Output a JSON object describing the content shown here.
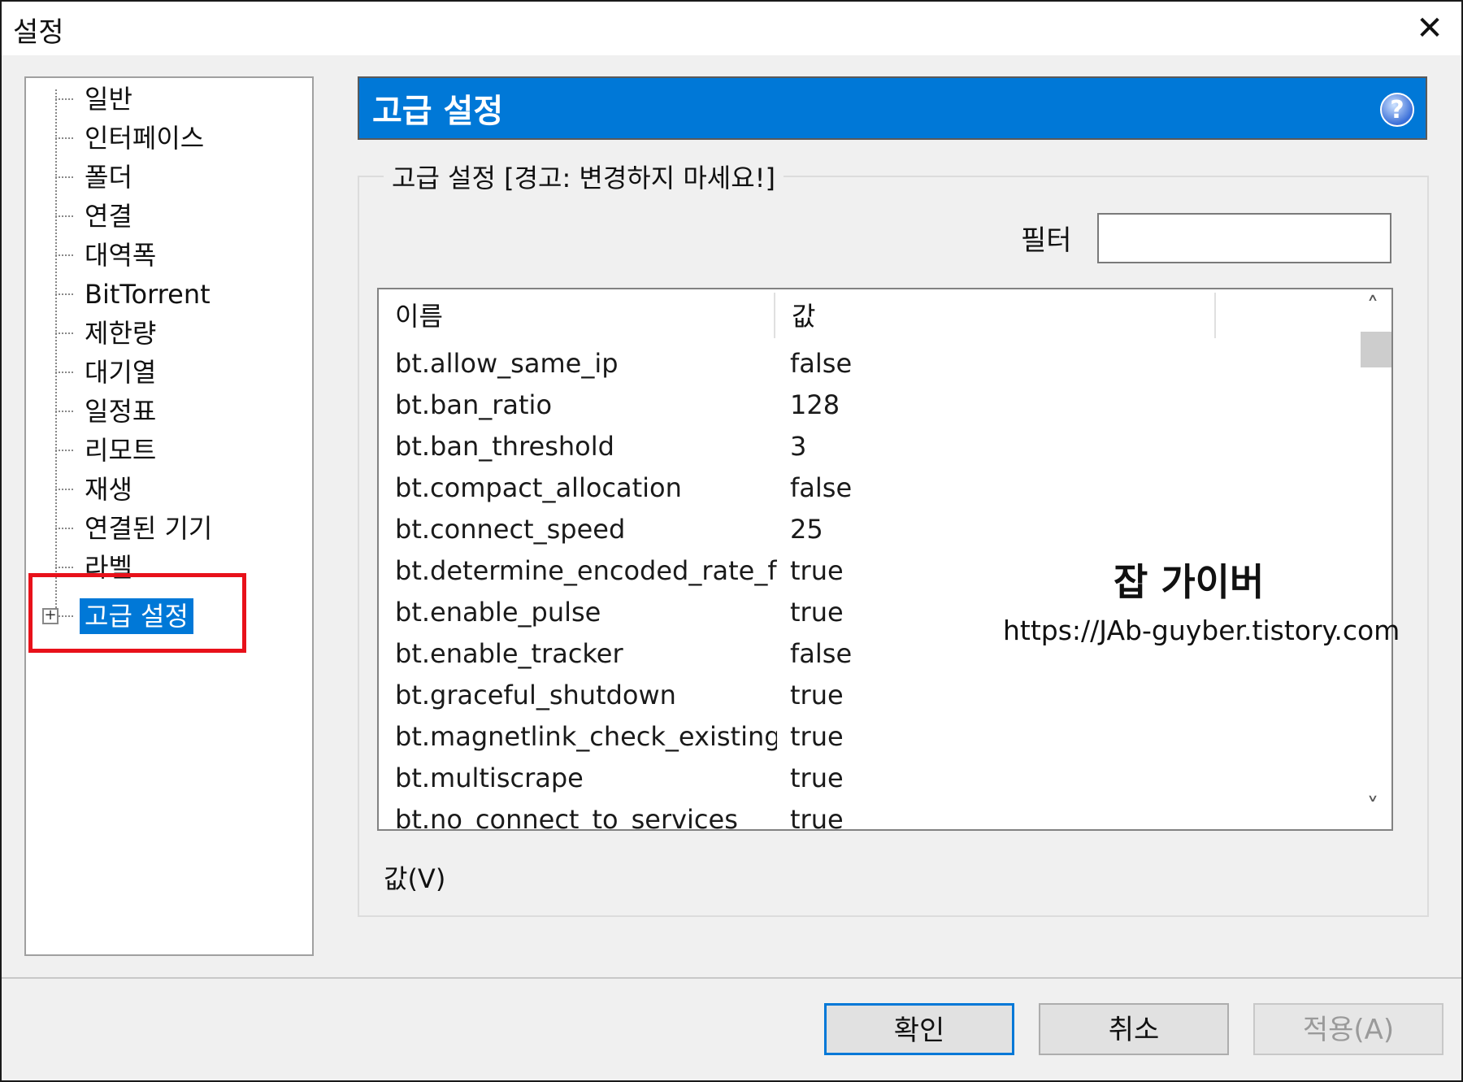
{
  "window": {
    "title": "설정",
    "close_glyph": "✕"
  },
  "tree": {
    "items": [
      {
        "label": "일반"
      },
      {
        "label": "인터페이스"
      },
      {
        "label": "폴더"
      },
      {
        "label": "연결"
      },
      {
        "label": "대역폭"
      },
      {
        "label": "BitTorrent"
      },
      {
        "label": "제한량"
      },
      {
        "label": "대기열"
      },
      {
        "label": "일정표"
      },
      {
        "label": "리모트"
      },
      {
        "label": "재생"
      },
      {
        "label": "연결된 기기"
      },
      {
        "label": "라벨"
      },
      {
        "label": "고급 설정",
        "selected": true
      }
    ],
    "expander_glyph": "+",
    "highlight_color": "#e8111a"
  },
  "panel": {
    "header_title": "고급 설정",
    "help_glyph": "?",
    "group_label": "고급 설정 [경고: 변경하지 마세요!]",
    "filter_label": "필터",
    "filter_value": "",
    "value_label": "값(V)"
  },
  "table": {
    "columns": [
      "이름",
      "값"
    ],
    "rows": [
      {
        "name": "bt.allow_same_ip",
        "value": "false"
      },
      {
        "name": "bt.ban_ratio",
        "value": "128"
      },
      {
        "name": "bt.ban_threshold",
        "value": "3"
      },
      {
        "name": "bt.compact_allocation",
        "value": "false"
      },
      {
        "name": "bt.connect_speed",
        "value": "25"
      },
      {
        "name": "bt.determine_encoded_rate_fo...",
        "value": "true"
      },
      {
        "name": "bt.enable_pulse",
        "value": "true"
      },
      {
        "name": "bt.enable_tracker",
        "value": "false"
      },
      {
        "name": "bt.graceful_shutdown",
        "value": "true"
      },
      {
        "name": "bt.magnetlink_check_existing_...",
        "value": "true"
      },
      {
        "name": "bt.multiscrape",
        "value": "true"
      },
      {
        "name": "bt.no_connect_to_services",
        "value": "true"
      }
    ],
    "scroll_up_glyph": "˄",
    "scroll_down_glyph": "˅"
  },
  "watermark": {
    "title": "잡 가이버",
    "url": "https://JAb-guyber.tistory.com"
  },
  "buttons": {
    "ok": "확인",
    "cancel": "취소",
    "apply": "적용(A)"
  },
  "colors": {
    "accent": "#0078d7",
    "highlight": "#e8111a"
  }
}
